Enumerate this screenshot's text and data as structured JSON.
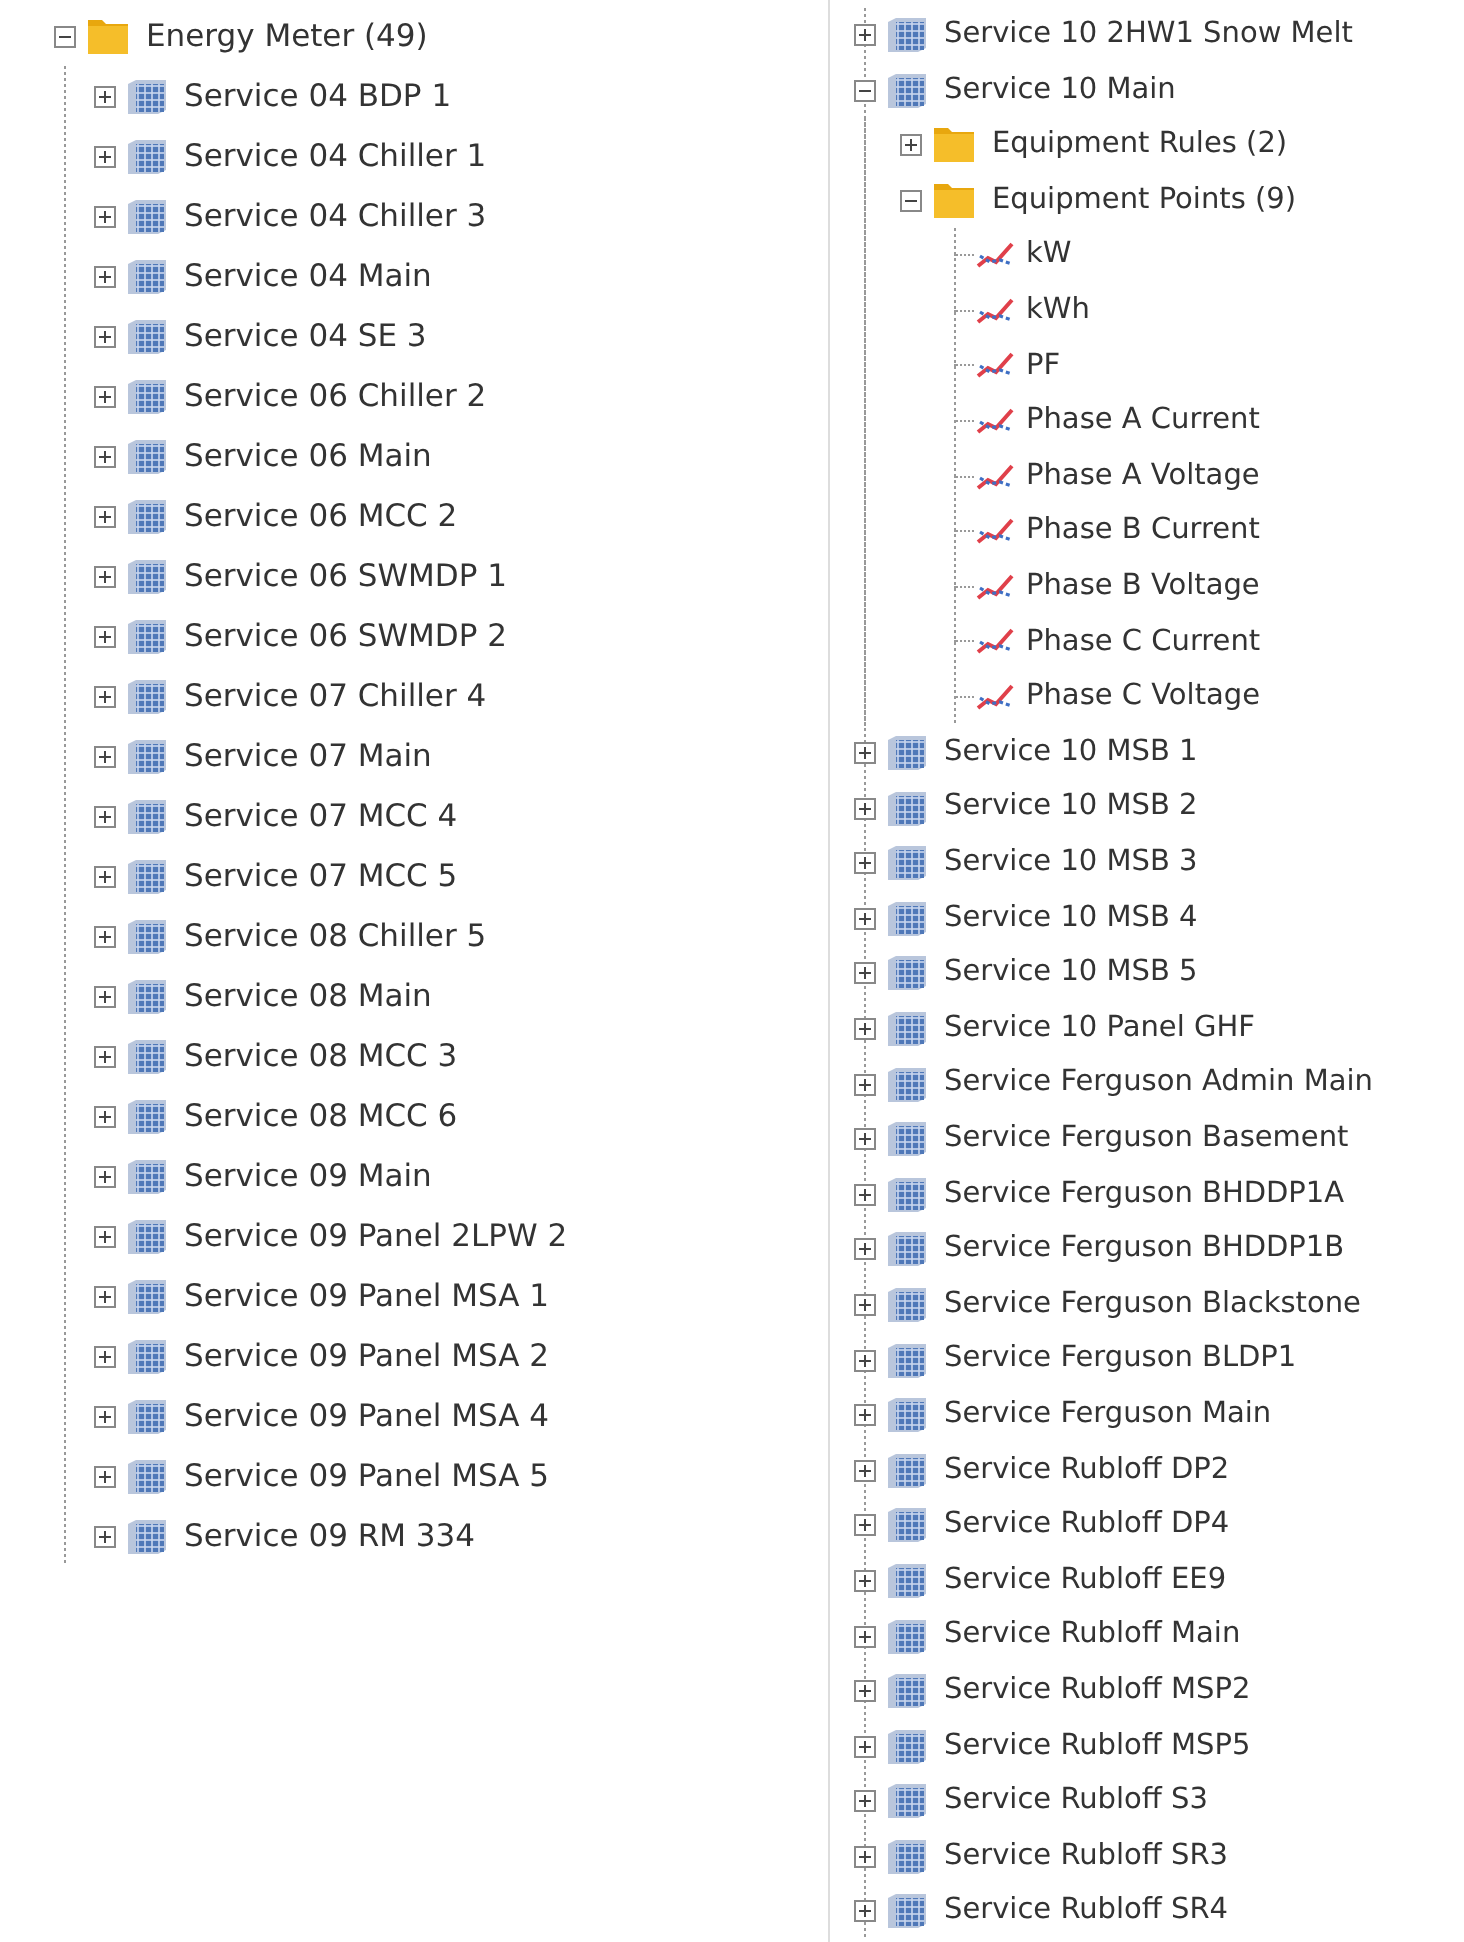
{
  "columns": [
    {
      "items": [
        {
          "label": "Energy Meter (49)",
          "kind": "folder",
          "expanded": true,
          "children": [
            {
              "label": "Service 04 BDP 1",
              "kind": "equipment",
              "expanded": false
            },
            {
              "label": "Service 04 Chiller 1",
              "kind": "equipment",
              "expanded": false
            },
            {
              "label": "Service 04 Chiller 3",
              "kind": "equipment",
              "expanded": false
            },
            {
              "label": "Service 04 Main",
              "kind": "equipment",
              "expanded": false
            },
            {
              "label": "Service 04 SE 3",
              "kind": "equipment",
              "expanded": false
            },
            {
              "label": "Service 06 Chiller 2",
              "kind": "equipment",
              "expanded": false
            },
            {
              "label": "Service 06 Main",
              "kind": "equipment",
              "expanded": false
            },
            {
              "label": "Service 06 MCC 2",
              "kind": "equipment",
              "expanded": false
            },
            {
              "label": "Service 06 SWMDP 1",
              "kind": "equipment",
              "expanded": false
            },
            {
              "label": "Service 06 SWMDP 2",
              "kind": "equipment",
              "expanded": false
            },
            {
              "label": "Service 07 Chiller 4",
              "kind": "equipment",
              "expanded": false
            },
            {
              "label": "Service 07 Main",
              "kind": "equipment",
              "expanded": false
            },
            {
              "label": "Service 07 MCC 4",
              "kind": "equipment",
              "expanded": false
            },
            {
              "label": "Service 07 MCC 5",
              "kind": "equipment",
              "expanded": false
            },
            {
              "label": "Service 08 Chiller 5",
              "kind": "equipment",
              "expanded": false
            },
            {
              "label": "Service 08 Main",
              "kind": "equipment",
              "expanded": false
            },
            {
              "label": "Service 08 MCC 3",
              "kind": "equipment",
              "expanded": false
            },
            {
              "label": "Service 08 MCC 6",
              "kind": "equipment",
              "expanded": false
            },
            {
              "label": "Service 09 Main",
              "kind": "equipment",
              "expanded": false
            },
            {
              "label": "Service 09 Panel 2LPW 2",
              "kind": "equipment",
              "expanded": false
            },
            {
              "label": "Service 09 Panel MSA 1",
              "kind": "equipment",
              "expanded": false
            },
            {
              "label": "Service 09 Panel MSA 2",
              "kind": "equipment",
              "expanded": false
            },
            {
              "label": "Service 09 Panel MSA 4",
              "kind": "equipment",
              "expanded": false
            },
            {
              "label": "Service 09 Panel MSA 5",
              "kind": "equipment",
              "expanded": false
            },
            {
              "label": "Service 09 RM 334",
              "kind": "equipment",
              "expanded": false
            }
          ]
        }
      ]
    },
    {
      "items": [
        {
          "label": "Service 10 2HW1 Snow Melt",
          "kind": "equipment",
          "expanded": false
        },
        {
          "label": "Service 10 Main",
          "kind": "equipment",
          "expanded": true,
          "children": [
            {
              "label": "Equipment Rules (2)",
              "kind": "folder",
              "expanded": false
            },
            {
              "label": "Equipment Points (9)",
              "kind": "folder",
              "expanded": true,
              "children": [
                {
                  "label": "kW",
                  "kind": "point"
                },
                {
                  "label": "kWh",
                  "kind": "point"
                },
                {
                  "label": "PF",
                  "kind": "point"
                },
                {
                  "label": "Phase A Current",
                  "kind": "point"
                },
                {
                  "label": "Phase A Voltage",
                  "kind": "point"
                },
                {
                  "label": "Phase B Current",
                  "kind": "point"
                },
                {
                  "label": "Phase B Voltage",
                  "kind": "point"
                },
                {
                  "label": "Phase C Current",
                  "kind": "point"
                },
                {
                  "label": "Phase C Voltage",
                  "kind": "point"
                }
              ]
            }
          ]
        },
        {
          "label": "Service 10 MSB 1",
          "kind": "equipment",
          "expanded": false
        },
        {
          "label": "Service 10 MSB 2",
          "kind": "equipment",
          "expanded": false
        },
        {
          "label": "Service 10 MSB 3",
          "kind": "equipment",
          "expanded": false
        },
        {
          "label": "Service 10 MSB 4",
          "kind": "equipment",
          "expanded": false
        },
        {
          "label": "Service 10 MSB 5",
          "kind": "equipment",
          "expanded": false
        },
        {
          "label": "Service 10 Panel GHF",
          "kind": "equipment",
          "expanded": false
        },
        {
          "label": "Service Ferguson Admin Main",
          "kind": "equipment",
          "expanded": false
        },
        {
          "label": "Service Ferguson Basement",
          "kind": "equipment",
          "expanded": false
        },
        {
          "label": "Service Ferguson BHDDP1A",
          "kind": "equipment",
          "expanded": false
        },
        {
          "label": "Service Ferguson BHDDP1B",
          "kind": "equipment",
          "expanded": false
        },
        {
          "label": "Service Ferguson Blackstone",
          "kind": "equipment",
          "expanded": false
        },
        {
          "label": "Service Ferguson BLDP1",
          "kind": "equipment",
          "expanded": false
        },
        {
          "label": "Service Ferguson Main",
          "kind": "equipment",
          "expanded": false
        },
        {
          "label": "Service Rubloff DP2",
          "kind": "equipment",
          "expanded": false
        },
        {
          "label": "Service Rubloff DP4",
          "kind": "equipment",
          "expanded": false
        },
        {
          "label": "Service Rubloff EE9",
          "kind": "equipment",
          "expanded": false
        },
        {
          "label": "Service Rubloff Main",
          "kind": "equipment",
          "expanded": false
        },
        {
          "label": "Service Rubloff MSP2",
          "kind": "equipment",
          "expanded": false
        },
        {
          "label": "Service Rubloff MSP5",
          "kind": "equipment",
          "expanded": false
        },
        {
          "label": "Service Rubloff S3",
          "kind": "equipment",
          "expanded": false
        },
        {
          "label": "Service Rubloff SR3",
          "kind": "equipment",
          "expanded": false
        },
        {
          "label": "Service Rubloff SR4",
          "kind": "equipment",
          "expanded": false
        }
      ]
    }
  ]
}
